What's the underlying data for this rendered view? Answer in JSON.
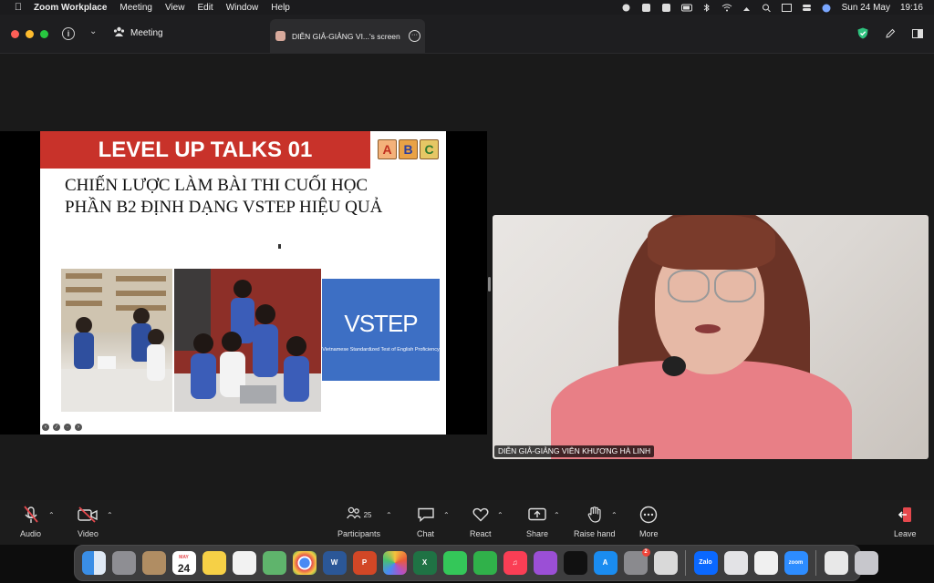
{
  "menubar": {
    "app_name": "Zoom Workplace",
    "items": [
      "Meeting",
      "View",
      "Edit",
      "Window",
      "Help"
    ],
    "date": "Sun 24 May",
    "time": "19:16"
  },
  "titlebar": {
    "meeting_label": "Meeting",
    "tab_label": "DIỄN GIẢ-GIẢNG VI...'s screen"
  },
  "slide": {
    "banner_title": "LEVEL UP TALKS 01",
    "abc": [
      "A",
      "B",
      "C"
    ],
    "heading_line1": "CHIẾN LƯỢC LÀM BÀI THI  CUỐI HỌC",
    "heading_line2": "PHẦN B2 ĐỊNH DẠNG VSTEP HIỆU QUẢ",
    "vstep_title": "VSTEP",
    "vstep_subtitle": "Vietnamese Standardized Test of English Proficiency"
  },
  "video": {
    "participant_name": "DIỄN GIẢ-GIẢNG VIÊN  KHƯƠNG HÀ LINH"
  },
  "toolbar": {
    "audio": "Audio",
    "video": "Video",
    "participants": "Participants",
    "participants_count": "25",
    "chat": "Chat",
    "react": "React",
    "share": "Share",
    "raise_hand": "Raise hand",
    "more": "More",
    "leave": "Leave"
  },
  "dock": {
    "calendar_month": "MAY",
    "calendar_day": "24",
    "appstore_badge": "2",
    "zalo_label": "Zalo",
    "zoom_label": "zoom"
  },
  "colors": {
    "banner_red": "#c8322a",
    "vstep_blue": "#3d6fc4",
    "leave_red": "#e5484d",
    "shield_green": "#2ec27e"
  }
}
